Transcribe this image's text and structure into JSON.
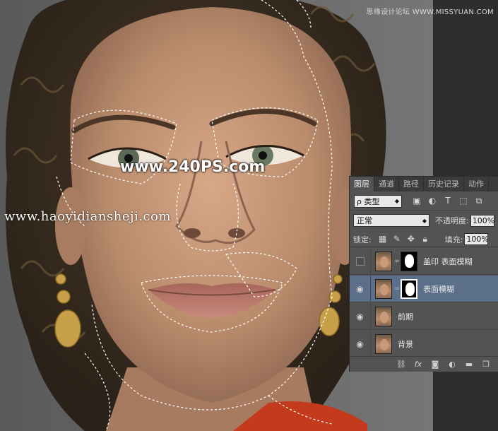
{
  "watermarks": {
    "top_right": "思缘设计论坛  WWW.MISSYUAN.COM",
    "center": "www.240PS.com",
    "url": "www.haoyidiansheji.com"
  },
  "colors": {
    "background_gray": "#6a6a6a",
    "skin": "#b98c6c",
    "hair": "#3b2f22",
    "panel_bg": "#535353",
    "panel_tab_bg": "#3b3b3b",
    "selected_layer": "#5b6f8a",
    "shirt": "#c43a1d"
  },
  "layers_panel": {
    "tabs": [
      "图层",
      "通道",
      "路径",
      "历史记录",
      "动作"
    ],
    "active_tab": "图层",
    "filter": {
      "kind_label": "ρ 类型",
      "icons": [
        "image-filter-icon",
        "adjustment-filter-icon",
        "type-filter-icon",
        "shape-filter-icon",
        "smart-object-filter-icon"
      ]
    },
    "blend_mode": "正常",
    "opacity_label": "不透明度:",
    "opacity_value": "100%",
    "lock_label": "锁定:",
    "fill_label": "填充:",
    "fill_value": "100%",
    "layers": [
      {
        "name": "盖印 表面模糊",
        "visible": false,
        "has_mask": true,
        "selected": false
      },
      {
        "name": "表面模糊",
        "visible": true,
        "has_mask": true,
        "selected": true
      },
      {
        "name": "前期",
        "visible": true,
        "has_mask": false,
        "selected": false
      },
      {
        "name": "背景",
        "visible": true,
        "has_mask": false,
        "selected": false
      }
    ],
    "bottom_icons": [
      "link-layers-icon",
      "fx-icon",
      "add-mask-icon",
      "adjustment-layer-icon",
      "new-group-icon",
      "new-layer-icon"
    ]
  }
}
